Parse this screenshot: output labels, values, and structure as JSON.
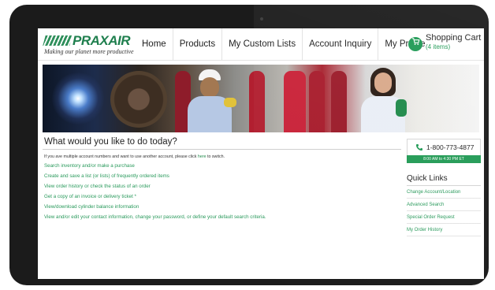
{
  "logo": {
    "name": "PRAXAIR",
    "tagline": "Making our planet more productive"
  },
  "nav": {
    "items": [
      "Home",
      "Products",
      "My Custom Lists",
      "Account Inquiry",
      "My Profile"
    ]
  },
  "cart": {
    "title": "Shopping Cart",
    "count": "(4 items)",
    "icon": "cart-icon"
  },
  "main": {
    "title": "What would you like to do today?",
    "intro_before": "If you ave multiple account numbers and want to use another account, please click ",
    "intro_link": "here",
    "intro_after": " to switch.",
    "links": [
      "Search inventory and/or make a purchase",
      "Create and save a list (or lists) of frequently ordered items",
      "View order history or check the status of an order",
      "Get a copy of an invoice or delivery ticket *",
      "View/download cylinder balance information",
      "View and/or edit your contact information, change your password, or define your default search criteria."
    ]
  },
  "sidebar": {
    "phone": "1-800-773-4877",
    "hours": "8:00 AM to 4:30 PM ET",
    "quick_links_title": "Quick Links",
    "quick_links": [
      "Change Account/Location",
      "Advanced Search",
      "Special Order Request",
      "My Order History"
    ]
  },
  "colors": {
    "brand_green": "#1f9a55",
    "link_green": "#2a9a5c"
  }
}
